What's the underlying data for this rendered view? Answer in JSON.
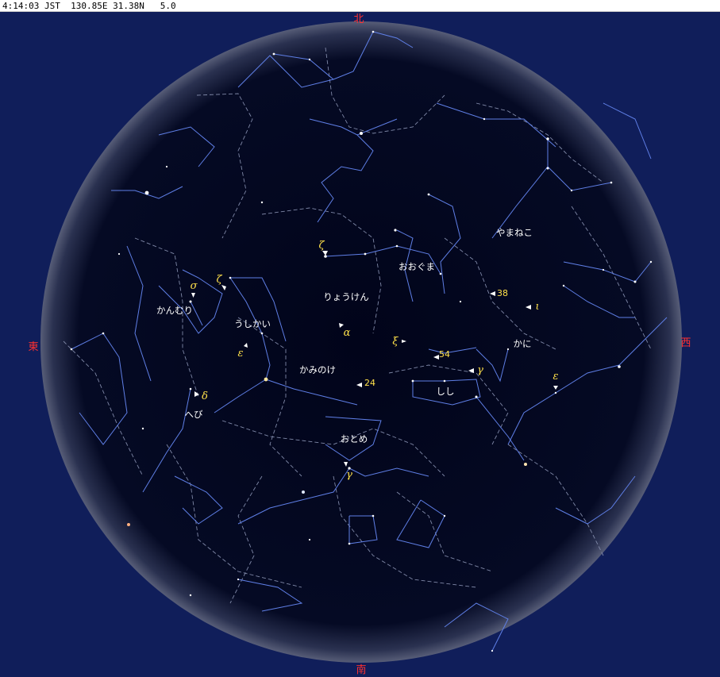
{
  "status": {
    "time": "4:14:03 JST",
    "location": "130.85E 31.38N",
    "magnitude_limit": "5.0"
  },
  "colors": {
    "background": "#101e5a",
    "sky": "#02051a",
    "constellation_lines": "#5f7fe6",
    "boundaries": "#8089a8",
    "direction_labels": "#ff3030",
    "star_labels": "#ffe14a",
    "constellation_names": "#ffffff"
  },
  "directions": {
    "north": "北",
    "south": "南",
    "east": "東",
    "west": "西"
  },
  "constellations": {
    "yamaneko": "やまねこ",
    "ooguma": "おおぐま",
    "ryouken": "りょうけん",
    "kanmuri": "かんむり",
    "ushikai": "うしかい",
    "kaminoke": "かみのけ",
    "kani": "かに",
    "shishi": "しし",
    "hebi": "へび",
    "otome": "おとめ"
  },
  "star_labels": {
    "zeta_uma": "ζ",
    "sigma_crb": "σ",
    "zeta_boo": "ζ",
    "alpha_cvn": "α",
    "xi_uma": "ξ",
    "n38_lyn": "38",
    "iota_cnc": "ι",
    "n54_leo": "54",
    "gamma_cnc": "γ",
    "epsilon_boo": "ε",
    "delta_ser": "δ",
    "n24_com": "24",
    "epsilon_hya": "ε",
    "gamma_vir": "γ"
  }
}
